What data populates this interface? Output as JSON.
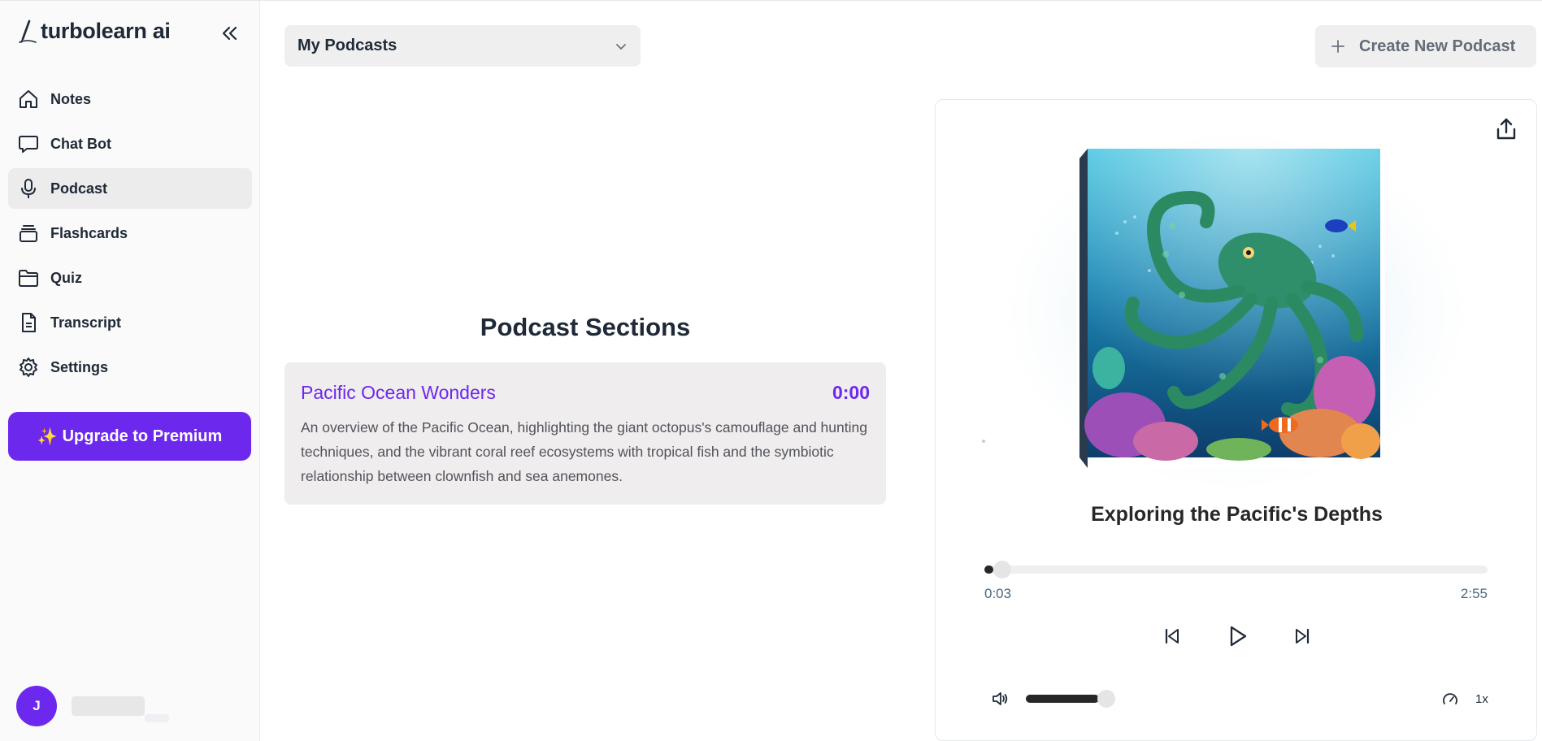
{
  "app": {
    "brand": "turbolearn ai",
    "accent_color": "#6d28ee"
  },
  "sidebar": {
    "items": [
      {
        "label": "Notes",
        "icon": "home-icon",
        "active": false
      },
      {
        "label": "Chat Bot",
        "icon": "chat-bubble-icon",
        "active": false
      },
      {
        "label": "Podcast",
        "icon": "microphone-icon",
        "active": true
      },
      {
        "label": "Flashcards",
        "icon": "cards-stack-icon",
        "active": false
      },
      {
        "label": "Quiz",
        "icon": "folder-icon",
        "active": false
      },
      {
        "label": "Transcript",
        "icon": "document-icon",
        "active": false
      },
      {
        "label": "Settings",
        "icon": "gear-icon",
        "active": false
      }
    ],
    "upgrade": {
      "icon": "✨",
      "label": "Upgrade to Premium"
    },
    "user": {
      "initial": "J"
    }
  },
  "header": {
    "podcast_select": "My Podcasts",
    "create_label": "Create New Podcast"
  },
  "sections": {
    "title": "Podcast Sections",
    "items": [
      {
        "name": "Pacific Ocean Wonders",
        "time": "0:00",
        "description": "An overview of the Pacific Ocean, highlighting the giant octopus's camouflage and hunting techniques, and the vibrant coral reef ecosystems with tropical fish and the symbiotic relationship between clownfish and sea anemones."
      }
    ]
  },
  "player": {
    "title": "Exploring the Pacific's Depths",
    "current_time": "0:03",
    "total_time": "2:55",
    "progress_fraction": 0.017,
    "volume_fraction": 0.82,
    "speed": "1x"
  }
}
